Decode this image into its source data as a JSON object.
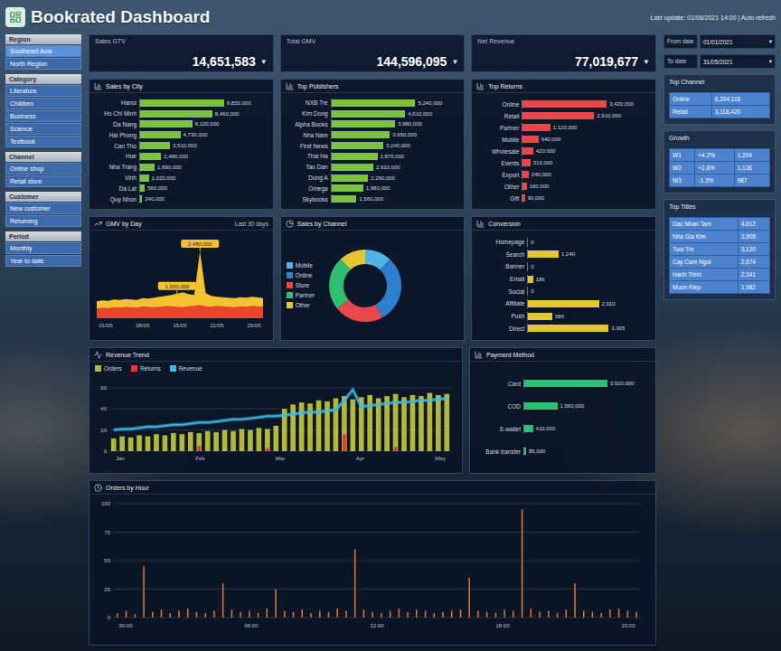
{
  "header": {
    "title": "Bookrated Dashboard",
    "info": "Last update: 01/06/2021 14:00 | Auto refresh"
  },
  "sidebar": [
    {
      "heading": "Region",
      "items": [
        {
          "label": "Southeast Asia",
          "selected": true
        },
        {
          "label": "North Region",
          "selected": false
        }
      ]
    },
    {
      "heading": "Category",
      "items": [
        {
          "label": "Literature",
          "selected": false
        },
        {
          "label": "Children",
          "selected": false
        },
        {
          "label": "Business",
          "selected": false
        },
        {
          "label": "Science",
          "selected": false
        },
        {
          "label": "Textbook",
          "selected": false
        }
      ]
    },
    {
      "heading": "Channel",
      "items": [
        {
          "label": "Online shop",
          "selected": false
        },
        {
          "label": "Retail store",
          "selected": false
        }
      ]
    },
    {
      "heading": "Customer",
      "items": [
        {
          "label": "New customer",
          "selected": false
        },
        {
          "label": "Returning",
          "selected": false
        }
      ]
    },
    {
      "heading": "Period",
      "items": [
        {
          "label": "Monthly",
          "selected": false
        },
        {
          "label": "Year to date",
          "selected": false
        }
      ]
    }
  ],
  "kpis": [
    {
      "label": "Sales GTV",
      "value": "14,651,583",
      "trend": "▼"
    },
    {
      "label": "Total GMV",
      "value": "144,596,095",
      "trend": "▼"
    },
    {
      "label": "Net Revenue",
      "value": "77,019,677",
      "trend": "▼"
    }
  ],
  "filters": [
    {
      "label": "From date",
      "value": "01/01/2021",
      "icon": "▾"
    },
    {
      "label": "To date",
      "value": "31/05/2021",
      "icon": "▾"
    }
  ],
  "side_panels": [
    {
      "title": "Top Channel",
      "rows": [
        [
          "Online",
          "6,204,118"
        ],
        [
          "Retail",
          "3,118,420"
        ]
      ]
    },
    {
      "title": "Growth",
      "rows": [
        [
          "W1",
          "+4.2%",
          "1,204"
        ],
        [
          "W2",
          "+2.8%",
          "1,136"
        ],
        [
          "W3",
          "-1.3%",
          "987"
        ]
      ]
    },
    {
      "title": "Top Titles",
      "rows": [
        [
          "Dac Nhan Tam",
          "4,812"
        ],
        [
          "Nha Gia Kim",
          "3,905"
        ],
        [
          "Tuoi Tre",
          "3,120"
        ],
        [
          "Cay Cam Ngot",
          "2,874"
        ],
        [
          "Hanh Trinh",
          "2,341"
        ],
        [
          "Muon Kiep",
          "1,982"
        ]
      ]
    }
  ],
  "bar_charts": [
    {
      "title": "Sales by City",
      "color": "#7dc142",
      "items": [
        {
          "label": "Hanoi",
          "value": 9850000,
          "display": "9,850,000"
        },
        {
          "label": "Ho Chi Minh",
          "value": 8460000,
          "display": "8,460,000"
        },
        {
          "label": "Da Nang",
          "value": 6120000,
          "display": "6,120,000"
        },
        {
          "label": "Hai Phong",
          "value": 4730000,
          "display": "4,730,000"
        },
        {
          "label": "Can Tho",
          "value": 3510000,
          "display": "3,510,000"
        },
        {
          "label": "Hue",
          "value": 2480000,
          "display": "2,480,000"
        },
        {
          "label": "Nha Trang",
          "value": 1690000,
          "display": "1,690,000"
        },
        {
          "label": "Vinh",
          "value": 1020000,
          "display": "1,020,000"
        },
        {
          "label": "Da Lat",
          "value": 560000,
          "display": "560,000"
        },
        {
          "label": "Quy Nhon",
          "value": 240000,
          "display": "240,000"
        }
      ]
    },
    {
      "title": "Top Publishers",
      "color": "#7dc142",
      "items": [
        {
          "label": "NXB Tre",
          "value": 5240000,
          "display": "5,240,000"
        },
        {
          "label": "Kim Dong",
          "value": 4610000,
          "display": "4,610,000"
        },
        {
          "label": "Alpha Books",
          "value": 3980000,
          "display": "3,980,000"
        },
        {
          "label": "Nha Nam",
          "value": 3650000,
          "display": "3,650,000"
        },
        {
          "label": "First News",
          "value": 3240000,
          "display": "3,240,000"
        },
        {
          "label": "Thai Ha",
          "value": 2870000,
          "display": "2,870,000"
        },
        {
          "label": "Tao Dan",
          "value": 2610000,
          "display": "2,610,000"
        },
        {
          "label": "Dong A",
          "value": 2290000,
          "display": "2,290,000"
        },
        {
          "label": "Omega",
          "value": 1980000,
          "display": "1,980,000"
        },
        {
          "label": "Skybooks",
          "value": 1560000,
          "display": "1,560,000"
        }
      ]
    },
    {
      "title": "Top Returns",
      "color": "#e8484a",
      "items": [
        {
          "label": "Online",
          "value": 3420000,
          "display": "3,420,000"
        },
        {
          "label": "Retail",
          "value": 2910000,
          "display": "2,910,000"
        },
        {
          "label": "Partner",
          "value": 1120000,
          "display": "1,120,000"
        },
        {
          "label": "Mobile",
          "value": 640000,
          "display": "640,000"
        },
        {
          "label": "Wholesale",
          "value": 420000,
          "display": "420,000"
        },
        {
          "label": "Events",
          "value": 310000,
          "display": "310,000"
        },
        {
          "label": "Export",
          "value": 240000,
          "display": "240,000"
        },
        {
          "label": "Other",
          "value": 160000,
          "display": "160,000"
        },
        {
          "label": "Gift",
          "value": 90000,
          "display": "90,000"
        }
      ]
    }
  ],
  "area_chart": {
    "title": "GMV by Day",
    "note": "Last 30 days",
    "max": 160,
    "series": [
      {
        "color": "#f2c230",
        "values": [
          38,
          40,
          39,
          42,
          41,
          43,
          42,
          41,
          45,
          44,
          46,
          48,
          50,
          52,
          55,
          58,
          54,
          52,
          150,
          56,
          50,
          48,
          47,
          46,
          45,
          47,
          46,
          48,
          47,
          45
        ]
      },
      {
        "color": "#e8452c",
        "values": [
          22,
          24,
          23,
          25,
          24,
          26,
          25,
          24,
          27,
          26,
          25,
          26,
          28,
          27,
          26,
          25,
          27,
          28,
          30,
          27,
          26,
          28,
          27,
          26,
          25,
          27,
          26,
          28,
          27,
          26
        ]
      }
    ],
    "annotations": [
      {
        "index": 18,
        "text": "2,480,000"
      },
      {
        "index": 14,
        "text": "1,020,000"
      }
    ],
    "x_ticks": [
      "01/05",
      "08/05",
      "15/05",
      "22/05",
      "29/05"
    ]
  },
  "donut_chart": {
    "title": "Sales by Channel",
    "segments": [
      {
        "label": "Mobile",
        "value": 12,
        "color": "#4fb3e8"
      },
      {
        "label": "Online",
        "value": 30,
        "color": "#2f7fd0"
      },
      {
        "label": "Store",
        "value": 22,
        "color": "#e8484a"
      },
      {
        "label": "Partner",
        "value": 24,
        "color": "#2fbf71"
      },
      {
        "label": "Other",
        "value": 12,
        "color": "#e2c72e"
      }
    ]
  },
  "conversion_chart": {
    "title": "Conversion",
    "color": "#e2c72e",
    "items": [
      {
        "label": "Homepage",
        "value": 0,
        "display": "0"
      },
      {
        "label": "Search",
        "value": 38,
        "display": "1,240"
      },
      {
        "label": "Banner",
        "value": 0,
        "display": "0"
      },
      {
        "label": "Email",
        "value": 6,
        "display": "186"
      },
      {
        "label": "Social",
        "value": 0,
        "display": "0"
      },
      {
        "label": "Affiliate",
        "value": 88,
        "display": "2,910"
      },
      {
        "label": "Push",
        "value": 30,
        "display": "980"
      },
      {
        "label": "Direct",
        "value": 100,
        "display": "3,305"
      }
    ]
  },
  "trend_chart": {
    "title": "Revenue Trend",
    "max": 70,
    "series": [
      {
        "label": "Orders",
        "color": "#b3b83c",
        "kind": "bar",
        "values": [
          12,
          14,
          13,
          15,
          14,
          16,
          15,
          17,
          16,
          18,
          17,
          19,
          18,
          20,
          19,
          21,
          20,
          22,
          21,
          24,
          40,
          44,
          46,
          45,
          48,
          47,
          50,
          52,
          49,
          51,
          53,
          50,
          52,
          54,
          51,
          53,
          52,
          55,
          53,
          54
        ]
      },
      {
        "label": "Returns",
        "color": "#e23b3b",
        "kind": "bar",
        "values": [
          0,
          0,
          0,
          0,
          0,
          0,
          0,
          0,
          0,
          0,
          5,
          0,
          0,
          0,
          0,
          0,
          0,
          0,
          3,
          0,
          0,
          0,
          0,
          0,
          0,
          0,
          0,
          16,
          0,
          0,
          0,
          0,
          0,
          4,
          0,
          0,
          0,
          0,
          0,
          0
        ]
      },
      {
        "label": "Revenue",
        "color": "#3fb8e8",
        "kind": "line",
        "values": [
          20,
          21,
          21,
          22,
          23,
          23,
          24,
          25,
          25,
          26,
          27,
          27,
          28,
          29,
          30,
          30,
          31,
          32,
          33,
          33,
          34,
          35,
          36,
          37,
          37,
          38,
          39,
          48,
          58,
          42,
          43,
          44,
          45,
          46,
          46,
          47,
          48,
          48,
          49,
          50
        ]
      }
    ],
    "y_ticks": [
      "60",
      "40",
      "20",
      "0"
    ],
    "x_ticks": [
      "Jan",
      "Feb",
      "Mar",
      "Apr",
      "May"
    ]
  },
  "payment_chart": {
    "title": "Payment Method",
    "color": "#2fbf71",
    "items": [
      {
        "label": "Card",
        "value": 3920000,
        "display": "3,920,000"
      },
      {
        "label": "COD",
        "value": 1560000,
        "display": "1,560,000"
      },
      {
        "label": "E-wallet",
        "value": 410000,
        "display": "410,000"
      },
      {
        "label": "Bank transfer",
        "value": 85000,
        "display": "85,000"
      }
    ]
  },
  "hourly_chart": {
    "title": "Orders by Hour",
    "max": 100,
    "color": "#e0783a",
    "values": [
      4,
      6,
      3,
      45,
      5,
      7,
      4,
      6,
      8,
      5,
      4,
      6,
      30,
      7,
      5,
      6,
      4,
      8,
      25,
      6,
      5,
      7,
      4,
      6,
      5,
      8,
      6,
      60,
      7,
      5,
      4,
      6,
      8,
      5,
      7,
      6,
      4,
      5,
      6,
      7,
      35,
      6,
      5,
      4,
      7,
      6,
      95,
      8,
      5,
      6,
      4,
      7,
      30,
      6,
      5,
      4,
      7,
      8,
      6,
      5
    ],
    "y_ticks": [
      "100",
      "75",
      "50",
      "25",
      "0"
    ],
    "x_ticks": [
      "00:00",
      "06:00",
      "12:00",
      "18:00",
      "23:00"
    ]
  }
}
